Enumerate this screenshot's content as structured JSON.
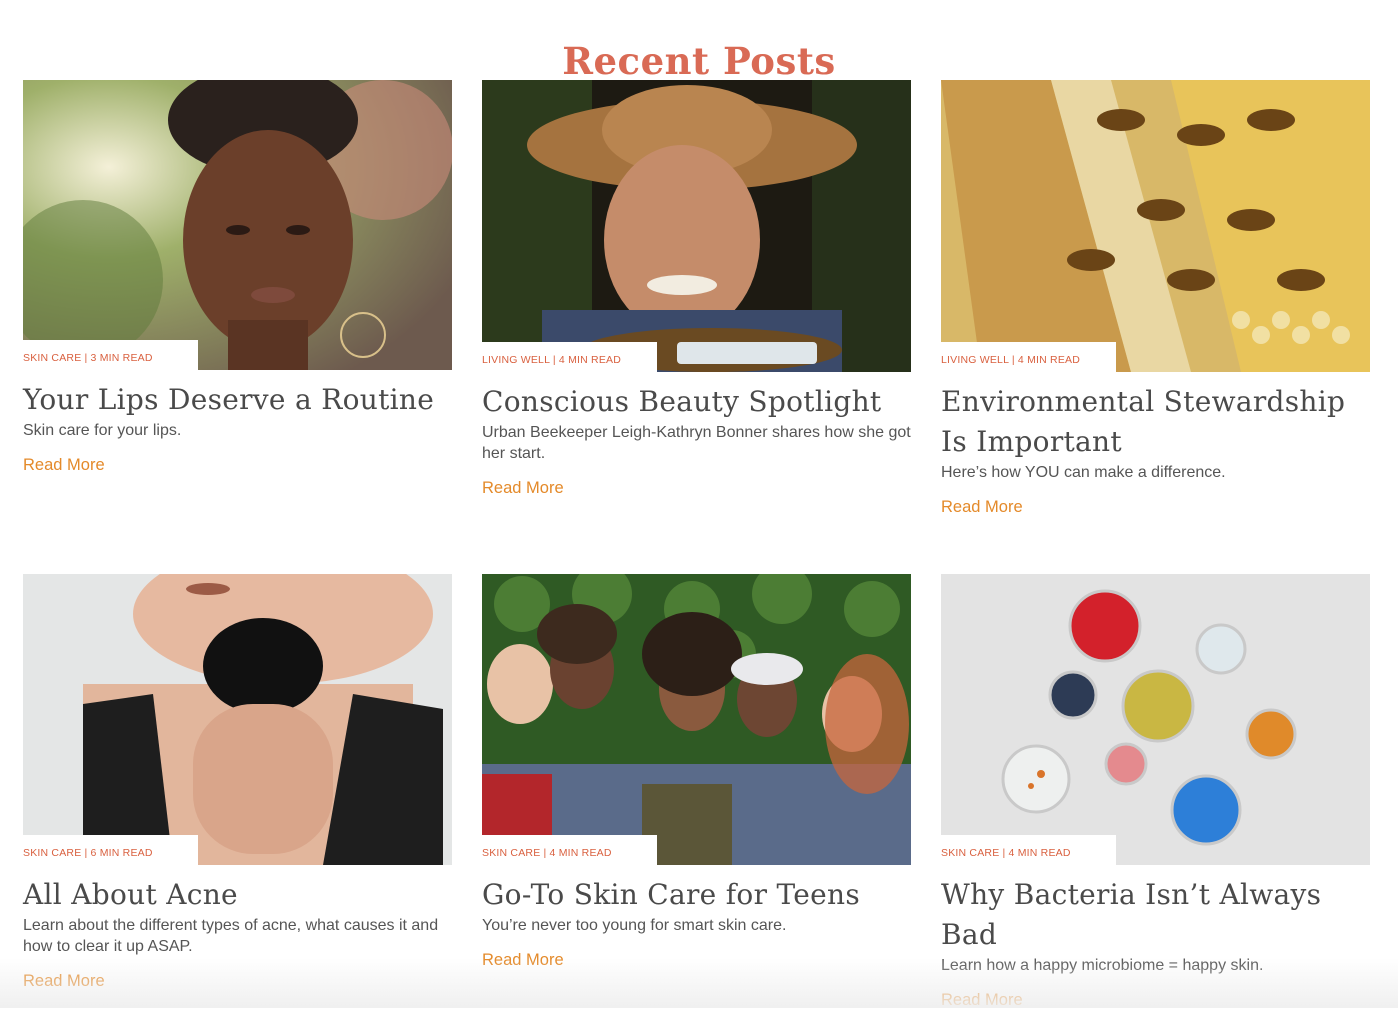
{
  "section": {
    "title": "Recent Posts"
  },
  "posts": [
    {
      "meta": "Skin Care | 3 Min Read",
      "title": "Your Lips Deserve a Routine",
      "excerpt": "Skin care for your lips.",
      "read_more": "Read More",
      "image": "woman-portrait-garden"
    },
    {
      "meta": "Living Well | 4 Min Read",
      "title": "Conscious Beauty Spotlight",
      "excerpt": "Urban Beekeeper Leigh-Kathryn Bonner shares how she got her start.",
      "read_more": "Read More",
      "image": "beekeeper-portrait"
    },
    {
      "meta": "Living Well | 4 Min Read",
      "title": "Environmental Stewardship Is Important",
      "excerpt": "Here’s how YOU can make a difference.",
      "read_more": "Read More",
      "image": "bees-on-honeycomb"
    },
    {
      "meta": "Skin Care | 6 Min Read",
      "title": "All About Acne",
      "excerpt": "Learn about the different types of acne, what causes it and how to clear it up ASAP.",
      "read_more": "Read More",
      "image": "woman-with-compact-mirror"
    },
    {
      "meta": "Skin Care | 4 Min Read",
      "title": "Go-To Skin Care for Teens",
      "excerpt": "You’re never too young for smart skin care.",
      "read_more": "Read More",
      "image": "group-of-teens"
    },
    {
      "meta": "Skin Care | 4 Min Read",
      "title": "Why Bacteria Isn’t Always Bad",
      "excerpt": "Learn how a happy microbiome = happy skin.",
      "read_more": "Read More",
      "image": "petri-dishes"
    }
  ],
  "colors": {
    "title": "#d96a55",
    "meta": "#d9603f",
    "link": "#e48a2a",
    "heading": "#4a4a4a",
    "text": "#555555"
  }
}
